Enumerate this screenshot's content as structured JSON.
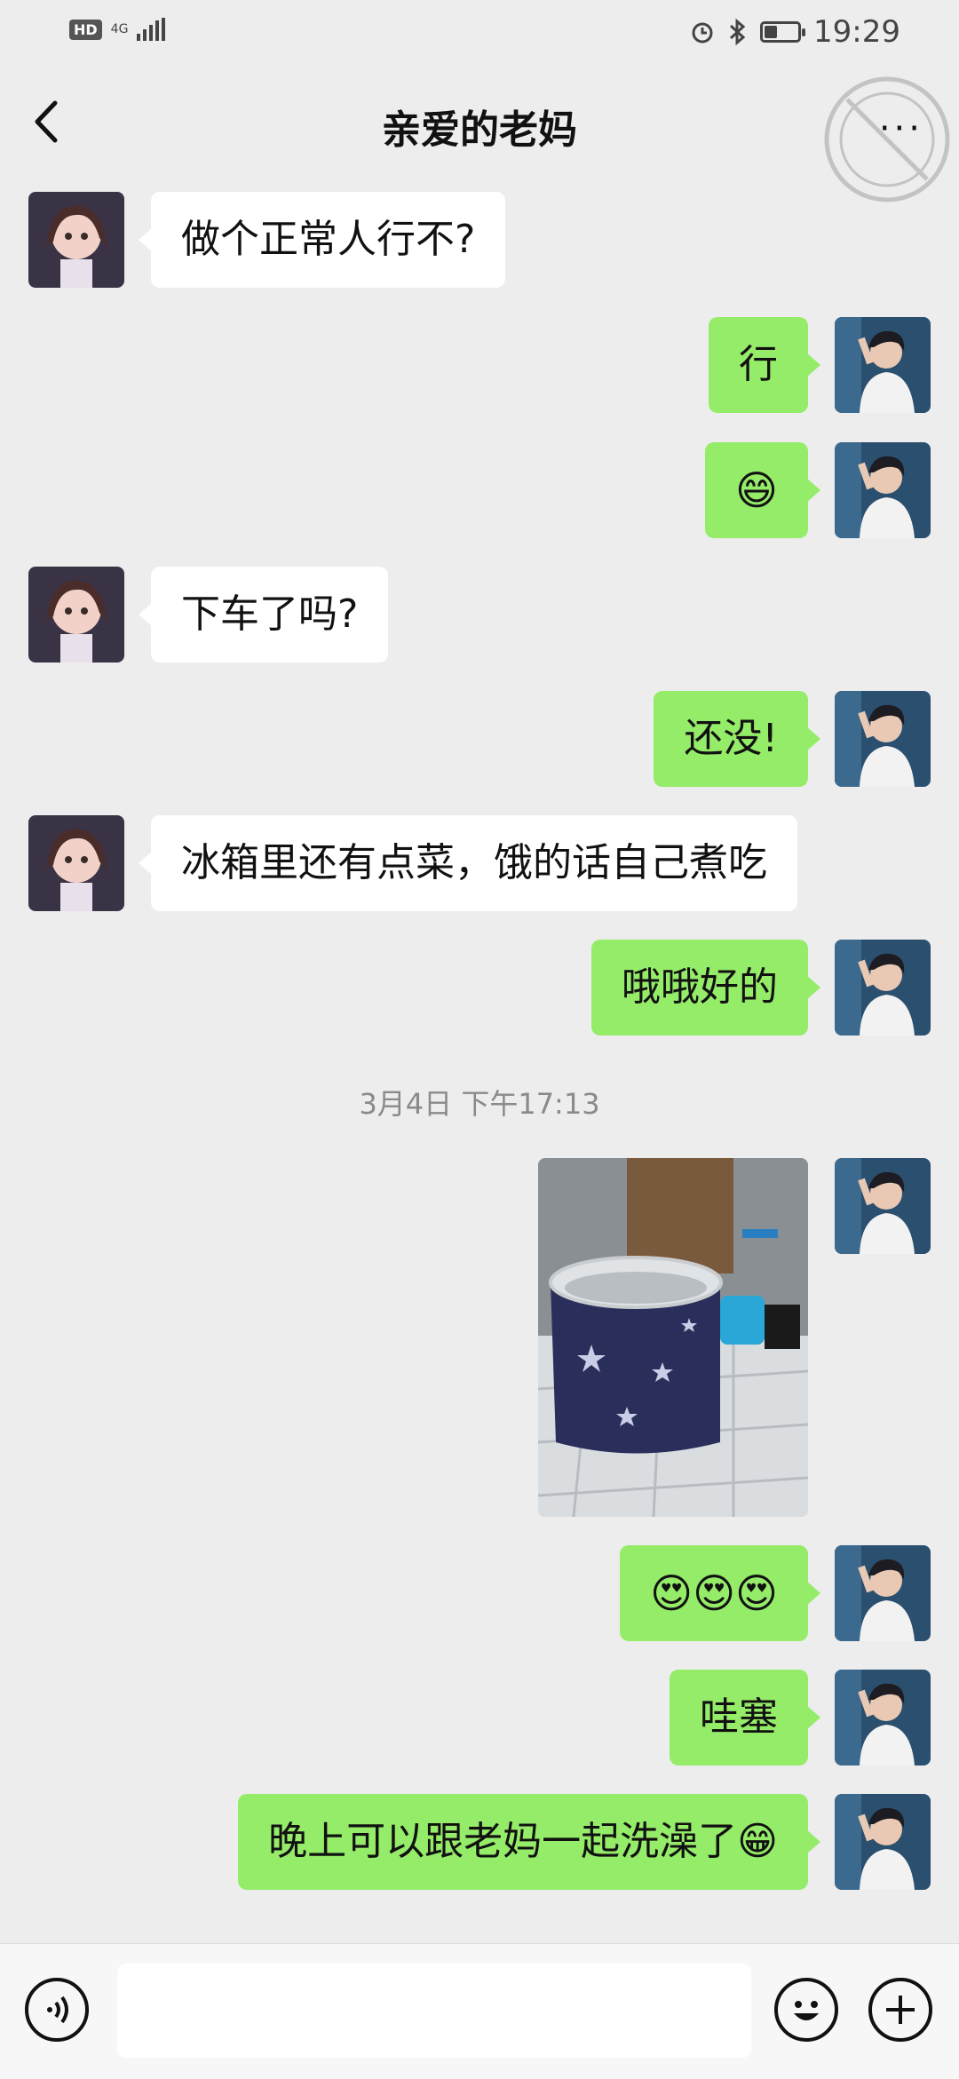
{
  "status_bar": {
    "hd": "HD",
    "network": "4G",
    "time": "19:29"
  },
  "header": {
    "title": "亲爱的老妈",
    "more": "···"
  },
  "messages": [
    {
      "side": "left",
      "text": "做个正常人行不?"
    },
    {
      "side": "right",
      "text": "行"
    },
    {
      "side": "right",
      "text": "😄",
      "is_emoji": true
    },
    {
      "side": "left",
      "text": "下车了吗?"
    },
    {
      "side": "right",
      "text": "还没!"
    },
    {
      "side": "left",
      "text": "冰箱里还有点菜，饿的话自己煮吃"
    },
    {
      "side": "right",
      "text": "哦哦好的"
    },
    {
      "timestamp": "3月4日 下午17:13"
    },
    {
      "side": "right",
      "image": "photo of a folding star-patterned bath tub in a tiled bathroom"
    },
    {
      "side": "right",
      "text": "😍😍😍",
      "is_emoji": true
    },
    {
      "side": "right",
      "text": "哇塞"
    },
    {
      "side": "right",
      "text": "晚上可以跟老妈一起洗澡了😁"
    }
  ],
  "input_bar": {
    "placeholder": ""
  },
  "colors": {
    "background": "#ededed",
    "sent_bubble": "#95ec69",
    "received_bubble": "#ffffff",
    "timestamp": "#8a8a8a"
  },
  "icons": [
    "back-icon",
    "more-icon",
    "voice-icon",
    "emoji-icon",
    "plus-icon"
  ]
}
